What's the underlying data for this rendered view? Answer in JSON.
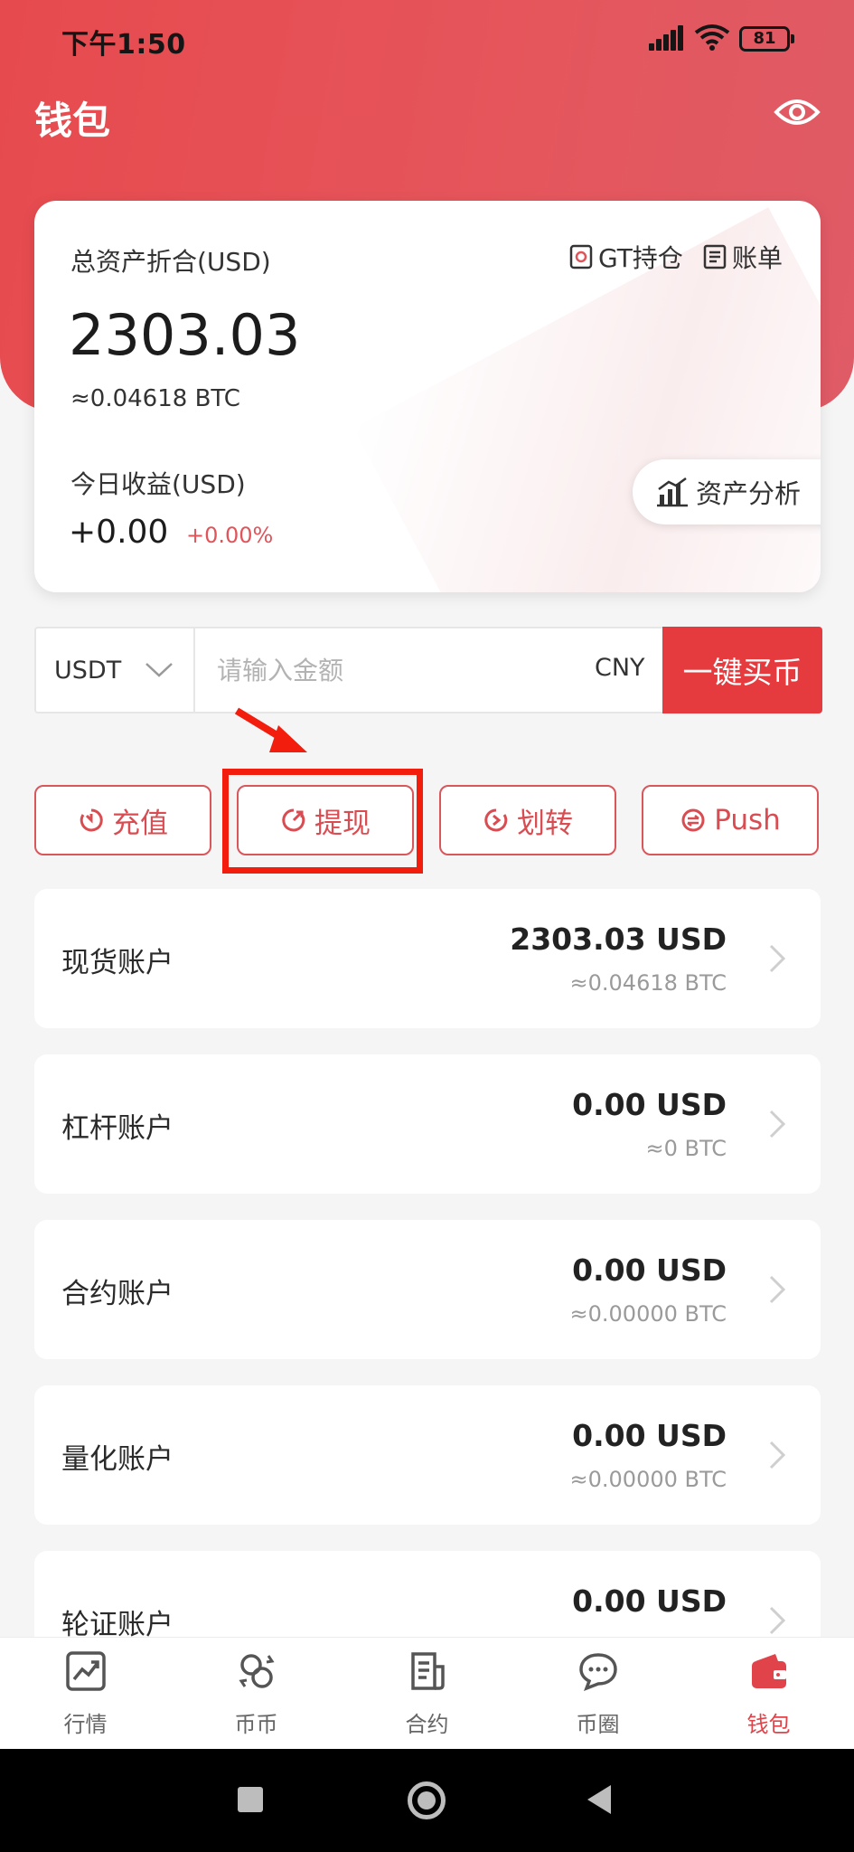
{
  "status_bar": {
    "time": "下午1:50",
    "battery": "81"
  },
  "header": {
    "title": "钱包",
    "visibility_icon": "eye-icon"
  },
  "asset_card": {
    "total_label": "总资产折合(USD)",
    "gt_holding_label": "GT持仓",
    "bill_label": "账单",
    "total_value": "2303.03",
    "total_btc": "≈0.04618 BTC",
    "today_label": "今日收益(USD)",
    "today_value": "+0.00",
    "today_percent": "+0.00%",
    "analysis_label": "资产分析"
  },
  "quick_buy": {
    "coin": "USDT",
    "amount_placeholder": "请输入金额",
    "fiat": "CNY",
    "buy_label": "一键买币"
  },
  "actions": [
    {
      "label": "充值",
      "icon": "deposit-icon"
    },
    {
      "label": "提现",
      "icon": "withdraw-icon"
    },
    {
      "label": "划转",
      "icon": "transfer-icon"
    },
    {
      "label": "Push",
      "icon": "push-icon"
    }
  ],
  "accounts": [
    {
      "name": "现货账户",
      "usd": "2303.03 USD",
      "btc": "≈0.04618 BTC"
    },
    {
      "name": "杠杆账户",
      "usd": "0.00 USD",
      "btc": "≈0 BTC"
    },
    {
      "name": "合约账户",
      "usd": "0.00 USD",
      "btc": "≈0.00000 BTC"
    },
    {
      "name": "量化账户",
      "usd": "0.00 USD",
      "btc": "≈0.00000 BTC"
    },
    {
      "name": "轮证账户",
      "usd": "0.00 USD",
      "btc": ""
    }
  ],
  "bottom_nav": [
    {
      "label": "行情",
      "icon": "market-chart-icon"
    },
    {
      "label": "币币",
      "icon": "coin-exchange-icon"
    },
    {
      "label": "合约",
      "icon": "contract-document-icon"
    },
    {
      "label": "币圈",
      "icon": "chat-bubble-icon"
    },
    {
      "label": "钱包",
      "icon": "wallet-icon",
      "active": true
    }
  ],
  "colors": {
    "brand_red": "#e53b3f",
    "header_red": "#e64a4e",
    "annotation_red": "#f21d0c"
  }
}
